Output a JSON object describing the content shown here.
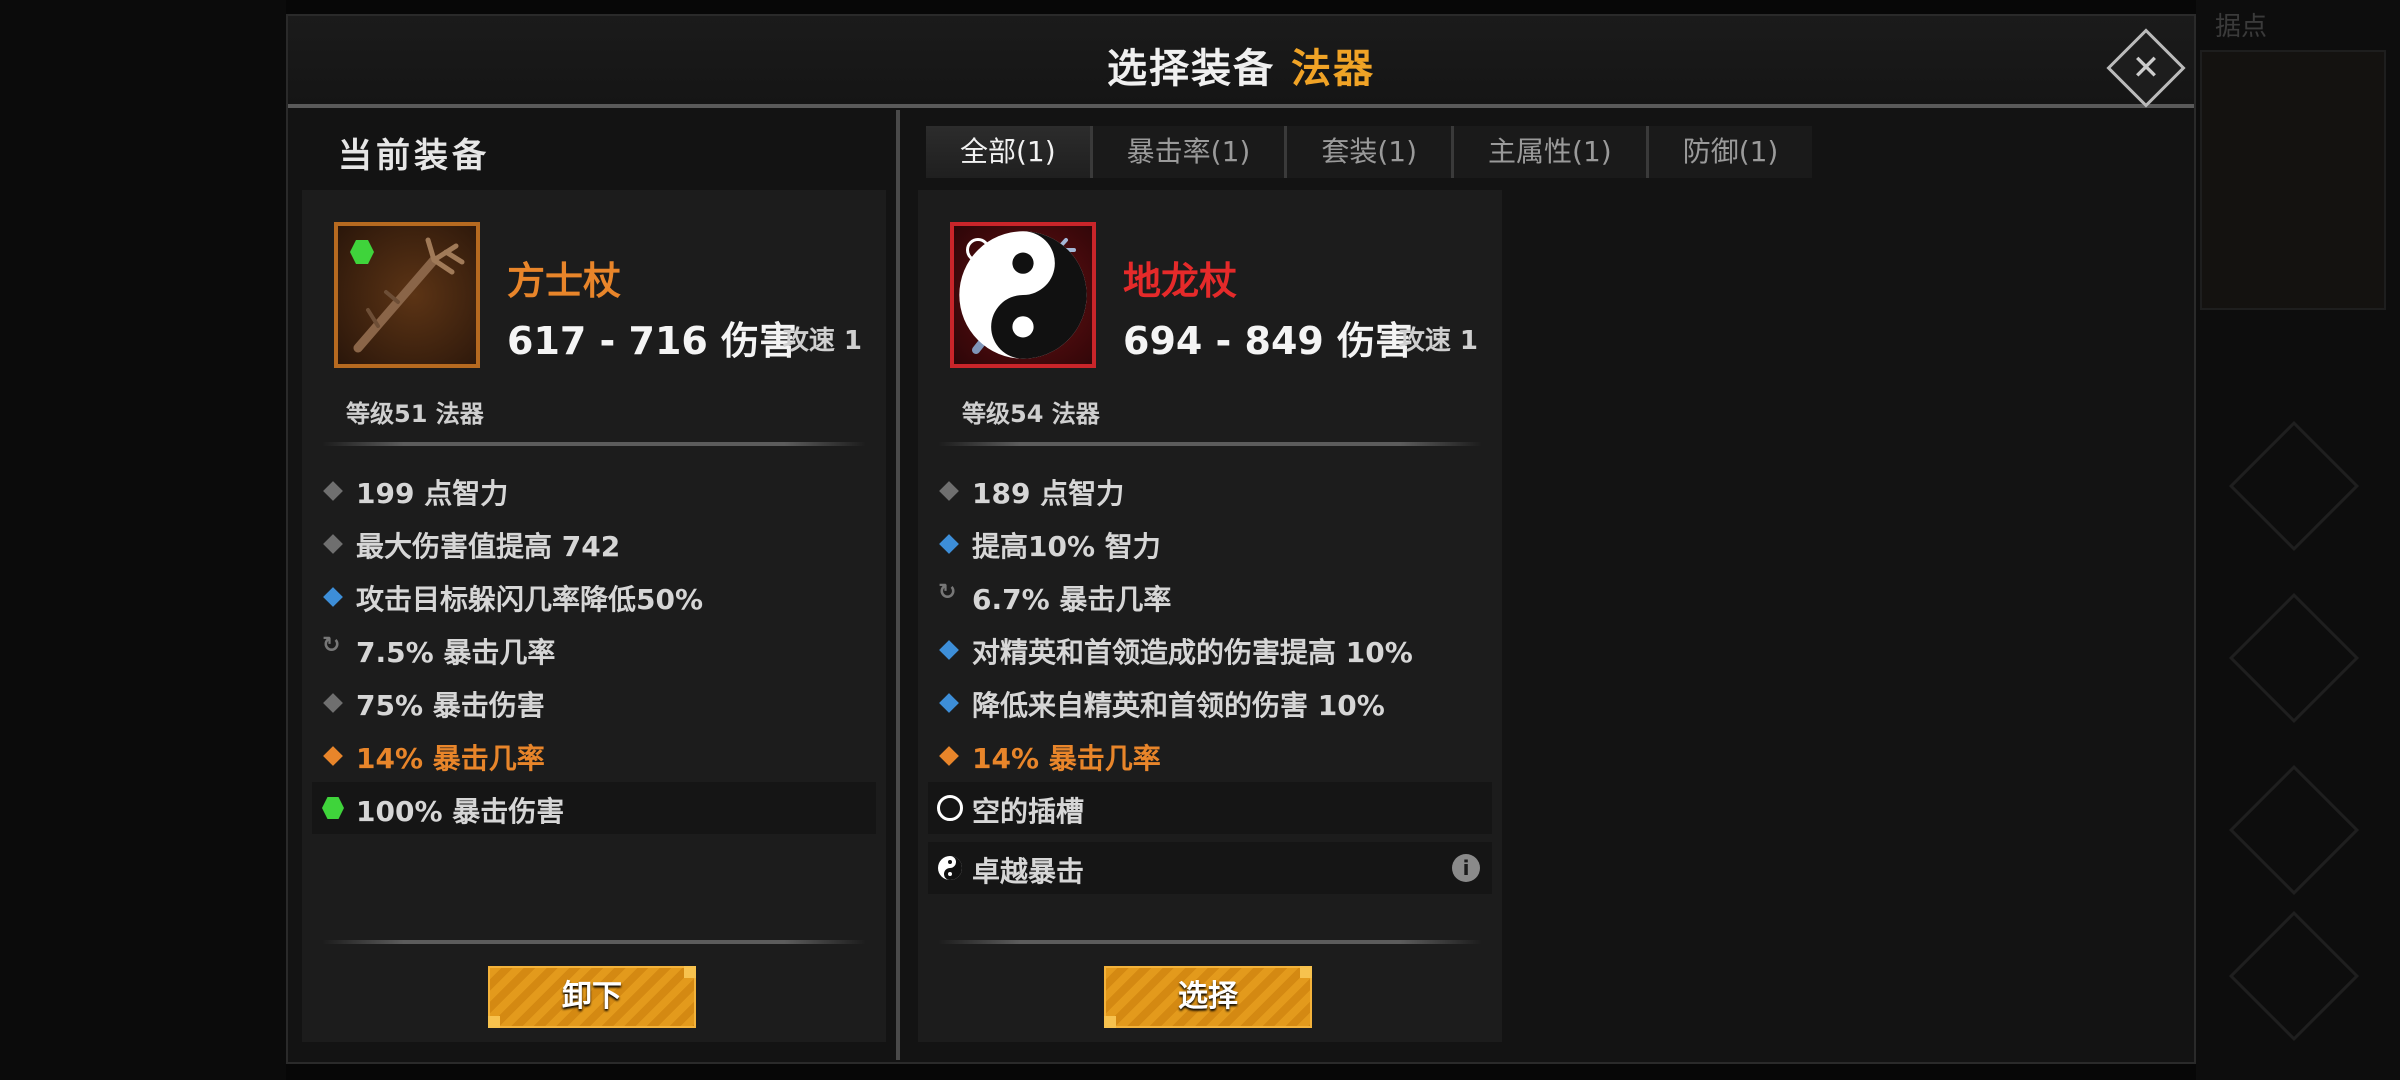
{
  "background": {
    "corner_label": "据点"
  },
  "header": {
    "title_prefix": "选择装备",
    "title_accent": "法器"
  },
  "current_section_title": "当前装备",
  "tabs": [
    {
      "label": "全部(1)",
      "active": true
    },
    {
      "label": "暴击率(1)",
      "active": false
    },
    {
      "label": "套装(1)",
      "active": false
    },
    {
      "label": "主属性(1)",
      "active": false
    },
    {
      "label": "防御(1)",
      "active": false
    }
  ],
  "current_item": {
    "name": "方士杖",
    "damage": "617 - 716 伤害",
    "attack_speed": "攻速 1",
    "level_type": "等级51 法器",
    "rarity_color": "#e8852a",
    "stats": [
      {
        "text": "199 点智力",
        "bullet": "grey"
      },
      {
        "text": "最大伤害值提高 742",
        "bullet": "grey"
      },
      {
        "text": "攻击目标躲闪几率降低50%",
        "bullet": "blue"
      },
      {
        "text": "7.5% 暴击几率",
        "bullet": "refresh"
      },
      {
        "text": "75% 暴击伤害",
        "bullet": "grey"
      },
      {
        "text": "14% 暴击几率",
        "bullet": "orange"
      },
      {
        "text": "100% 暴击伤害",
        "bullet": "gem"
      }
    ],
    "action_label": "卸下"
  },
  "candidate_item": {
    "name": "地龙杖",
    "damage": "694 - 849 伤害",
    "attack_speed": "攻速 1",
    "level_type": "等级54 法器",
    "rarity_color": "#e52a2a",
    "stats": [
      {
        "text": "189 点智力",
        "bullet": "grey"
      },
      {
        "text": "提高10% 智力",
        "bullet": "blue"
      },
      {
        "text": "6.7% 暴击几率",
        "bullet": "refresh"
      },
      {
        "text": "对精英和首领造成的伤害提高 10%",
        "bullet": "blue"
      },
      {
        "text": "降低来自精英和首领的伤害 10%",
        "bullet": "blue"
      },
      {
        "text": "14% 暴击几率",
        "bullet": "orange"
      },
      {
        "text": "空的插槽",
        "bullet": "circle"
      },
      {
        "text": "卓越暴击",
        "bullet": "yy"
      }
    ],
    "action_label": "选择"
  },
  "icons": {
    "close": "close-icon",
    "info": "info-icon",
    "refresh": "refresh-icon"
  }
}
